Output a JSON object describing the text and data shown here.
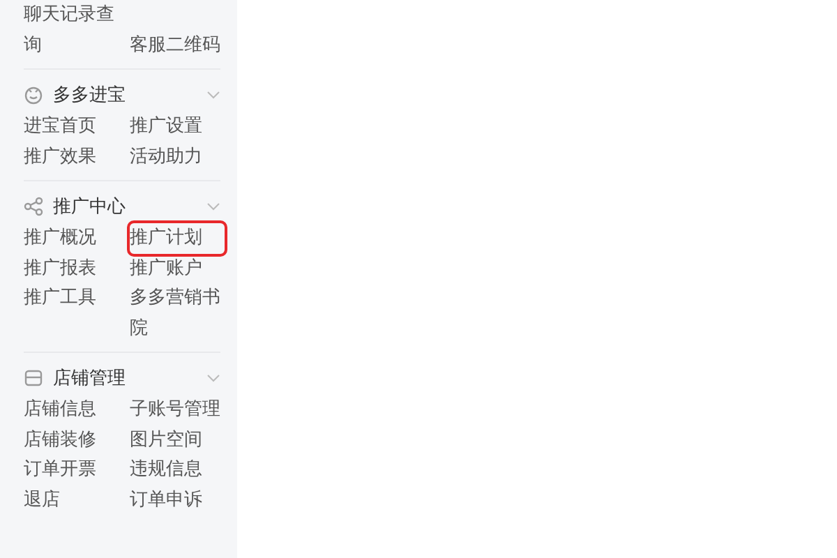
{
  "top_items": [
    {
      "label": "聊天记录查询",
      "highlighted": false
    },
    {
      "label": "客服二维码",
      "highlighted": false
    }
  ],
  "sections": [
    {
      "title": "多多进宝",
      "expanded": true,
      "items": [
        {
          "label": "进宝首页",
          "highlighted": false
        },
        {
          "label": "推广设置",
          "highlighted": false
        },
        {
          "label": "推广效果",
          "highlighted": false
        },
        {
          "label": "活动助力",
          "highlighted": false
        }
      ]
    },
    {
      "title": "推广中心",
      "expanded": true,
      "items": [
        {
          "label": "推广概况",
          "highlighted": false
        },
        {
          "label": "推广计划",
          "highlighted": true
        },
        {
          "label": "推广报表",
          "highlighted": false
        },
        {
          "label": "推广账户",
          "highlighted": false
        },
        {
          "label": "推广工具",
          "highlighted": false
        },
        {
          "label": "多多营销书院",
          "highlighted": false
        }
      ]
    },
    {
      "title": "店铺管理",
      "expanded": true,
      "items": [
        {
          "label": "店铺信息",
          "highlighted": false
        },
        {
          "label": "子账号管理",
          "highlighted": false
        },
        {
          "label": "店铺装修",
          "highlighted": false
        },
        {
          "label": "图片空间",
          "highlighted": false
        },
        {
          "label": "订单开票",
          "highlighted": false
        },
        {
          "label": "违规信息",
          "highlighted": false
        },
        {
          "label": "退店",
          "highlighted": false
        },
        {
          "label": "订单申诉",
          "highlighted": false
        }
      ]
    }
  ]
}
